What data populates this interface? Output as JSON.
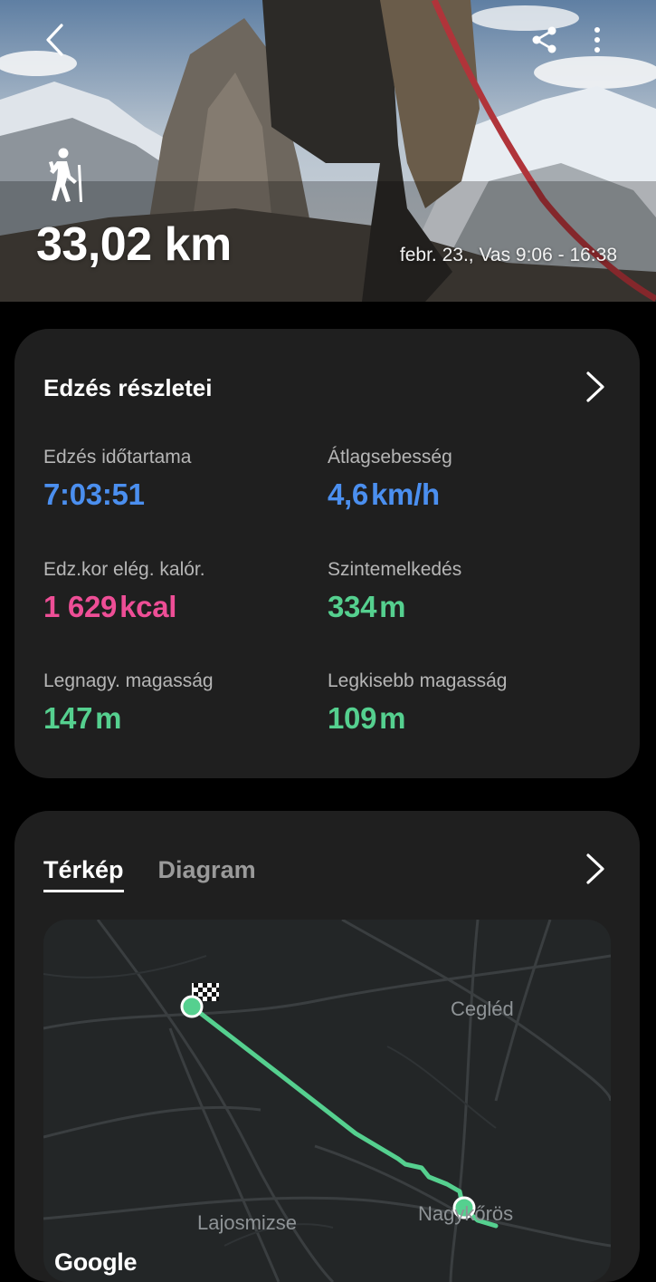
{
  "hero": {
    "distance": "33,02 km",
    "datetime": "febr. 23., Vas 9:06 - 16:38",
    "activity_icon": "hiking-icon",
    "back_icon": "chevron-left-icon",
    "share_icon": "share-icon",
    "more_icon": "more-vertical-icon"
  },
  "details": {
    "title": "Edzés részletei",
    "stats": [
      {
        "label": "Edzés időtartama",
        "value": "7:03:51",
        "unit": "",
        "color": "#4b8fef"
      },
      {
        "label": "Átlagsebesség",
        "value": "4,6",
        "unit": "km/h",
        "color": "#4b8fef"
      },
      {
        "label": "Edz.kor elég. kalór.",
        "value": "1 629",
        "unit": "kcal",
        "color": "#ee4e96"
      },
      {
        "label": "Szintemelkedés",
        "value": "334",
        "unit": "m",
        "color": "#55d08f"
      },
      {
        "label": "Legnagy. magasság",
        "value": "147",
        "unit": "m",
        "color": "#55d08f"
      },
      {
        "label": "Legkisebb magasság",
        "value": "109",
        "unit": "m",
        "color": "#55d08f"
      }
    ]
  },
  "map_card": {
    "tabs": [
      {
        "label": "Térkép",
        "active": true
      },
      {
        "label": "Diagram",
        "active": false
      }
    ],
    "places": [
      "Cegléd",
      "Lajosmizse",
      "Nagykőrös"
    ],
    "attribution": "Google",
    "route_color": "#55d08f"
  }
}
